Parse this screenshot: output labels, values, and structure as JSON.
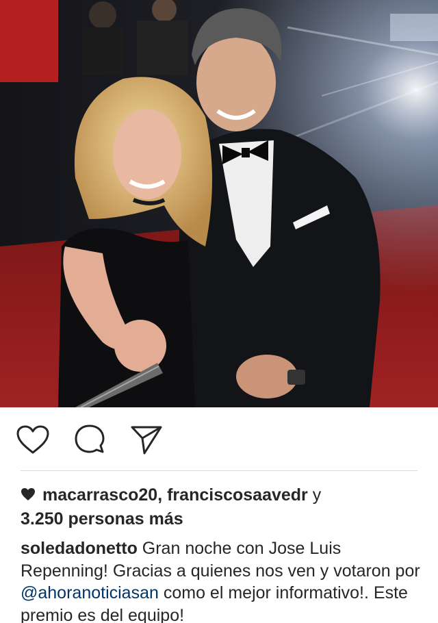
{
  "post": {
    "photo": {
      "description_icon": "photo-image"
    },
    "actions": {
      "like_icon": "heart-outline-icon",
      "comment_icon": "comment-bubble-icon",
      "share_icon": "paper-plane-icon"
    },
    "likes": {
      "icon": "heart-filled-icon",
      "user1": "macarrasco20",
      "sep1": ", ",
      "user2": "franciscosaavedr",
      "conj": " y",
      "others": "3.250 personas más"
    },
    "caption": {
      "username": "soledadonetto",
      "text_before": " Gran noche con Jose Luis Repenning! Gracias a quienes nos ven y votaron por ",
      "mention": "@ahoranoticiasan",
      "text_after": " como el mejor informativo!. Este premio es del equipo!"
    }
  },
  "colors": {
    "text": "#262626",
    "mention": "#003569",
    "divider": "#dbdbdb",
    "carpet": "#8e1b1b"
  }
}
